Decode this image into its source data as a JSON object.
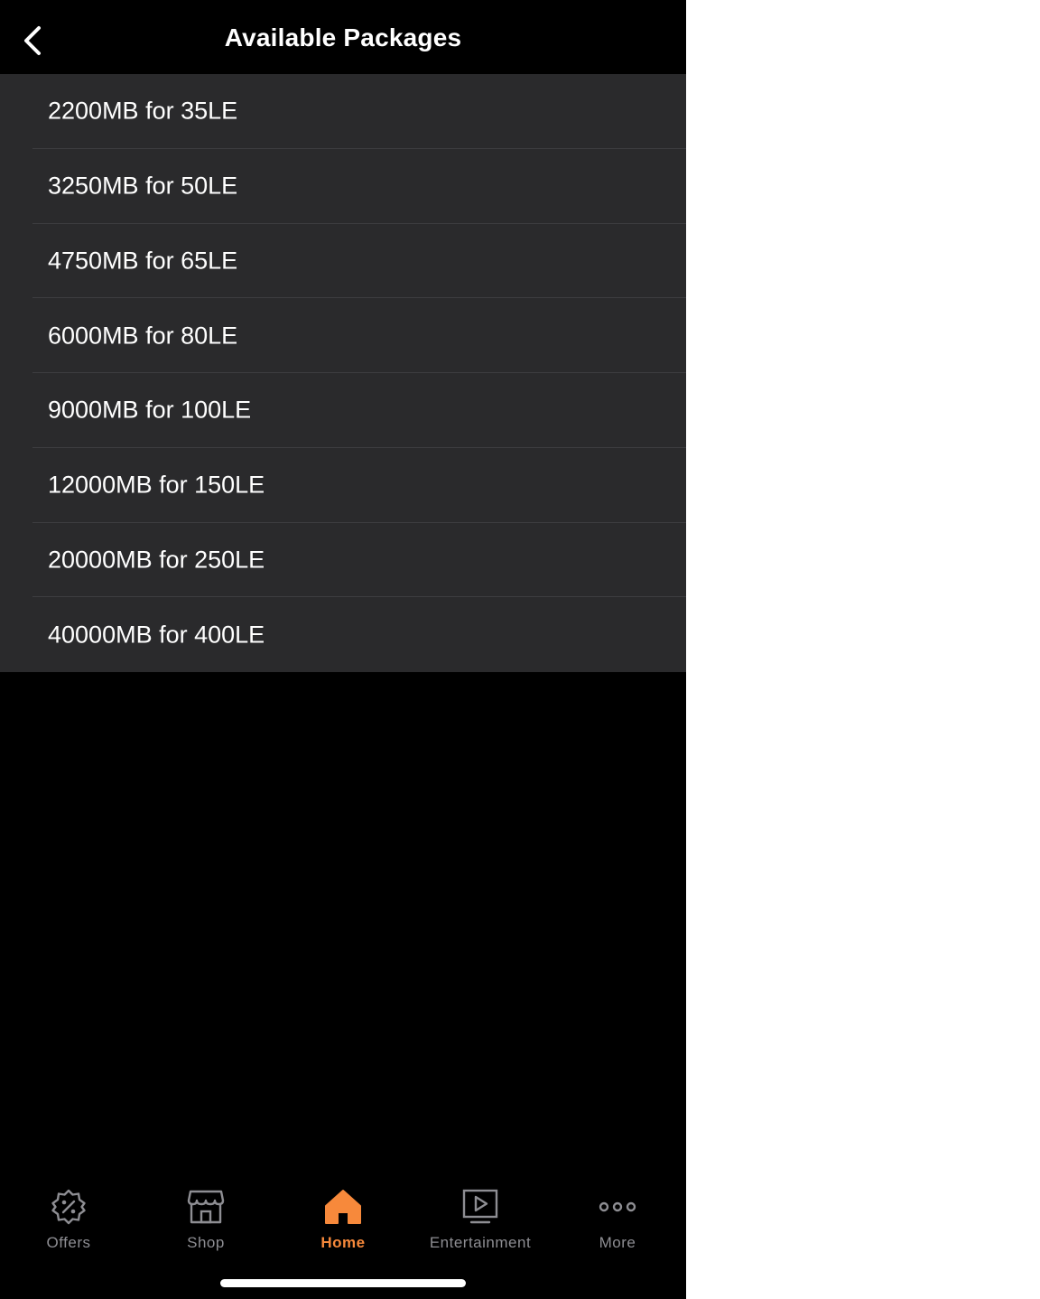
{
  "header": {
    "title": "Available Packages"
  },
  "packages": [
    {
      "label": "2200MB for 35LE"
    },
    {
      "label": "3250MB for 50LE"
    },
    {
      "label": "4750MB for 65LE"
    },
    {
      "label": "6000MB for 80LE"
    },
    {
      "label": "9000MB for 100LE"
    },
    {
      "label": "12000MB for 150LE"
    },
    {
      "label": "20000MB for 250LE"
    },
    {
      "label": "40000MB for 400LE"
    }
  ],
  "tabbar": {
    "tabs": [
      {
        "label": "Offers",
        "icon": "offers-percent-badge-icon"
      },
      {
        "label": "Shop",
        "icon": "store-icon"
      },
      {
        "label": "Home",
        "icon": "home-icon",
        "active": true
      },
      {
        "label": "Entertainment",
        "icon": "play-screen-icon"
      },
      {
        "label": "More",
        "icon": "more-dots-icon"
      }
    ]
  },
  "colors": {
    "background": "#000000",
    "list_background": "#2a2a2c",
    "accent": "#f7893b",
    "inactive": "#8e8e93",
    "text": "#ffffff"
  }
}
